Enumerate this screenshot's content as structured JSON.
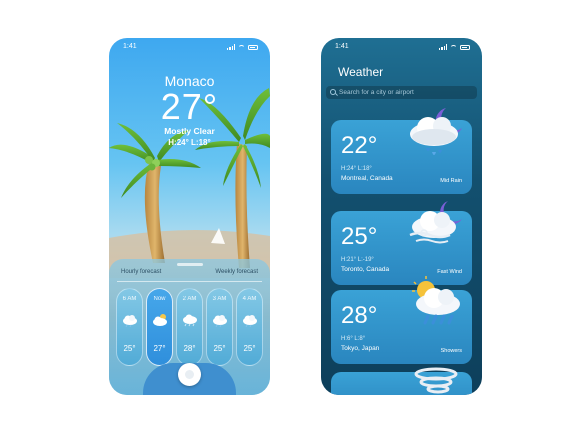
{
  "colors": {
    "phone1_sky": "#3ea8f0",
    "phone2_bg": "#13506f",
    "card": "#2a86bf"
  },
  "phone1": {
    "status_time": "1:41",
    "city": "Monaco",
    "temperature": "27°",
    "condition": "Mostly Clear",
    "high_low": "H:24° L:18°",
    "tabs": {
      "hourly": "Hourly forecast",
      "weekly": "Weekly forecast"
    },
    "hourly": [
      {
        "time": "6 AM",
        "temp": "25°",
        "icon": "cloud-icon"
      },
      {
        "time": "Now",
        "temp": "27°",
        "icon": "cloud-sun-icon"
      },
      {
        "time": "2 AM",
        "temp": "28°",
        "icon": "cloud-rain-icon"
      },
      {
        "time": "3 AM",
        "temp": "25°",
        "icon": "cloud-icon"
      },
      {
        "time": "4 AM",
        "temp": "25°",
        "icon": "cloud-icon"
      }
    ]
  },
  "phone2": {
    "status_time": "1:41",
    "title": "Weather",
    "search_placeholder": "Search for a city or airport",
    "cards": [
      {
        "temp": "22°",
        "hilo": "H:24° L:18°",
        "location": "Montreal, Canada",
        "condition": "Mid Rain",
        "icon": "moon-cloud-rain-icon"
      },
      {
        "temp": "25°",
        "hilo": "H:21° L:-19°",
        "location": "Toronto, Canada",
        "condition": "Fast Wind",
        "icon": "moon-cloud-wind-icon"
      },
      {
        "temp": "28°",
        "hilo": "H:6° L:8°",
        "location": "Tokyo, Japan",
        "condition": "Showers",
        "icon": "sun-cloud-rain-icon"
      },
      {
        "temp": "",
        "hilo": "",
        "location": "",
        "condition": "",
        "icon": "tornado-icon"
      }
    ]
  }
}
